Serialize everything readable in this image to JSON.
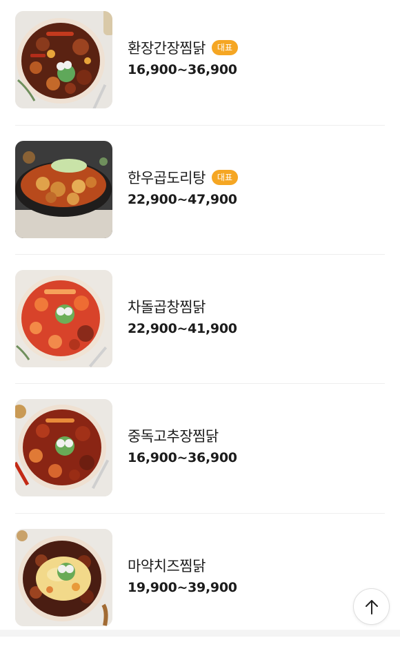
{
  "menu": {
    "items": [
      {
        "name": "환장간장찜닭",
        "badge": "대표",
        "price": "16,900~36,900",
        "image": "dish-photo"
      },
      {
        "name": "한우곱도리탕",
        "badge": "대표",
        "price": "22,900~47,900",
        "image": "dish-photo"
      },
      {
        "name": "차돌곱창찜닭",
        "badge": "",
        "price": "22,900~41,900",
        "image": "dish-photo"
      },
      {
        "name": "중독고추장찜닭",
        "badge": "",
        "price": "16,900~36,900",
        "image": "dish-photo"
      },
      {
        "name": "마약치즈찜닭",
        "badge": "",
        "price": "19,900~39,900",
        "image": "dish-photo"
      }
    ]
  },
  "scroll_top": {
    "icon": "arrow-up-icon"
  },
  "colors": {
    "badge": "#f5a623",
    "text": "#1c1c1c",
    "divider": "#eeeeee"
  }
}
